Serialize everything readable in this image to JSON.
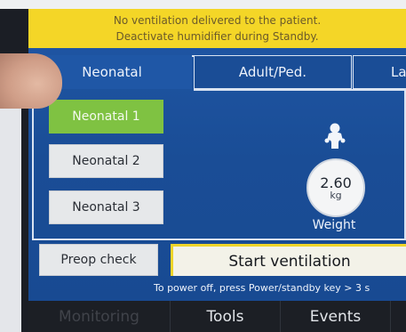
{
  "banner": {
    "line1": "No ventilation delivered to the patient.",
    "line2": "Deactivate humidifier during Standby."
  },
  "tabs": [
    {
      "label": "Neonatal",
      "active": true
    },
    {
      "label": "Adult/Ped.",
      "active": false
    },
    {
      "label": "La",
      "active": false
    }
  ],
  "presets": [
    {
      "label": "Neonatal 1",
      "selected": true
    },
    {
      "label": "Neonatal 2",
      "selected": false
    },
    {
      "label": "Neonatal 3",
      "selected": false
    }
  ],
  "weight": {
    "value": "2.60",
    "unit": "kg",
    "label": "Weight",
    "icon": "infant-icon"
  },
  "actions": {
    "preop_label": "Preop check",
    "start_label": "Start ventilation"
  },
  "power_hint": "To power off, press Power/standby key > 3 s",
  "bottom_nav": [
    {
      "label": "Monitoring"
    },
    {
      "label": "Tools"
    },
    {
      "label": "Events"
    }
  ],
  "colors": {
    "screen_blue": "#1f57a6",
    "banner_yellow": "#f4d627",
    "selected_green": "#7fc242",
    "start_border_yellow": "#f0d52a"
  }
}
